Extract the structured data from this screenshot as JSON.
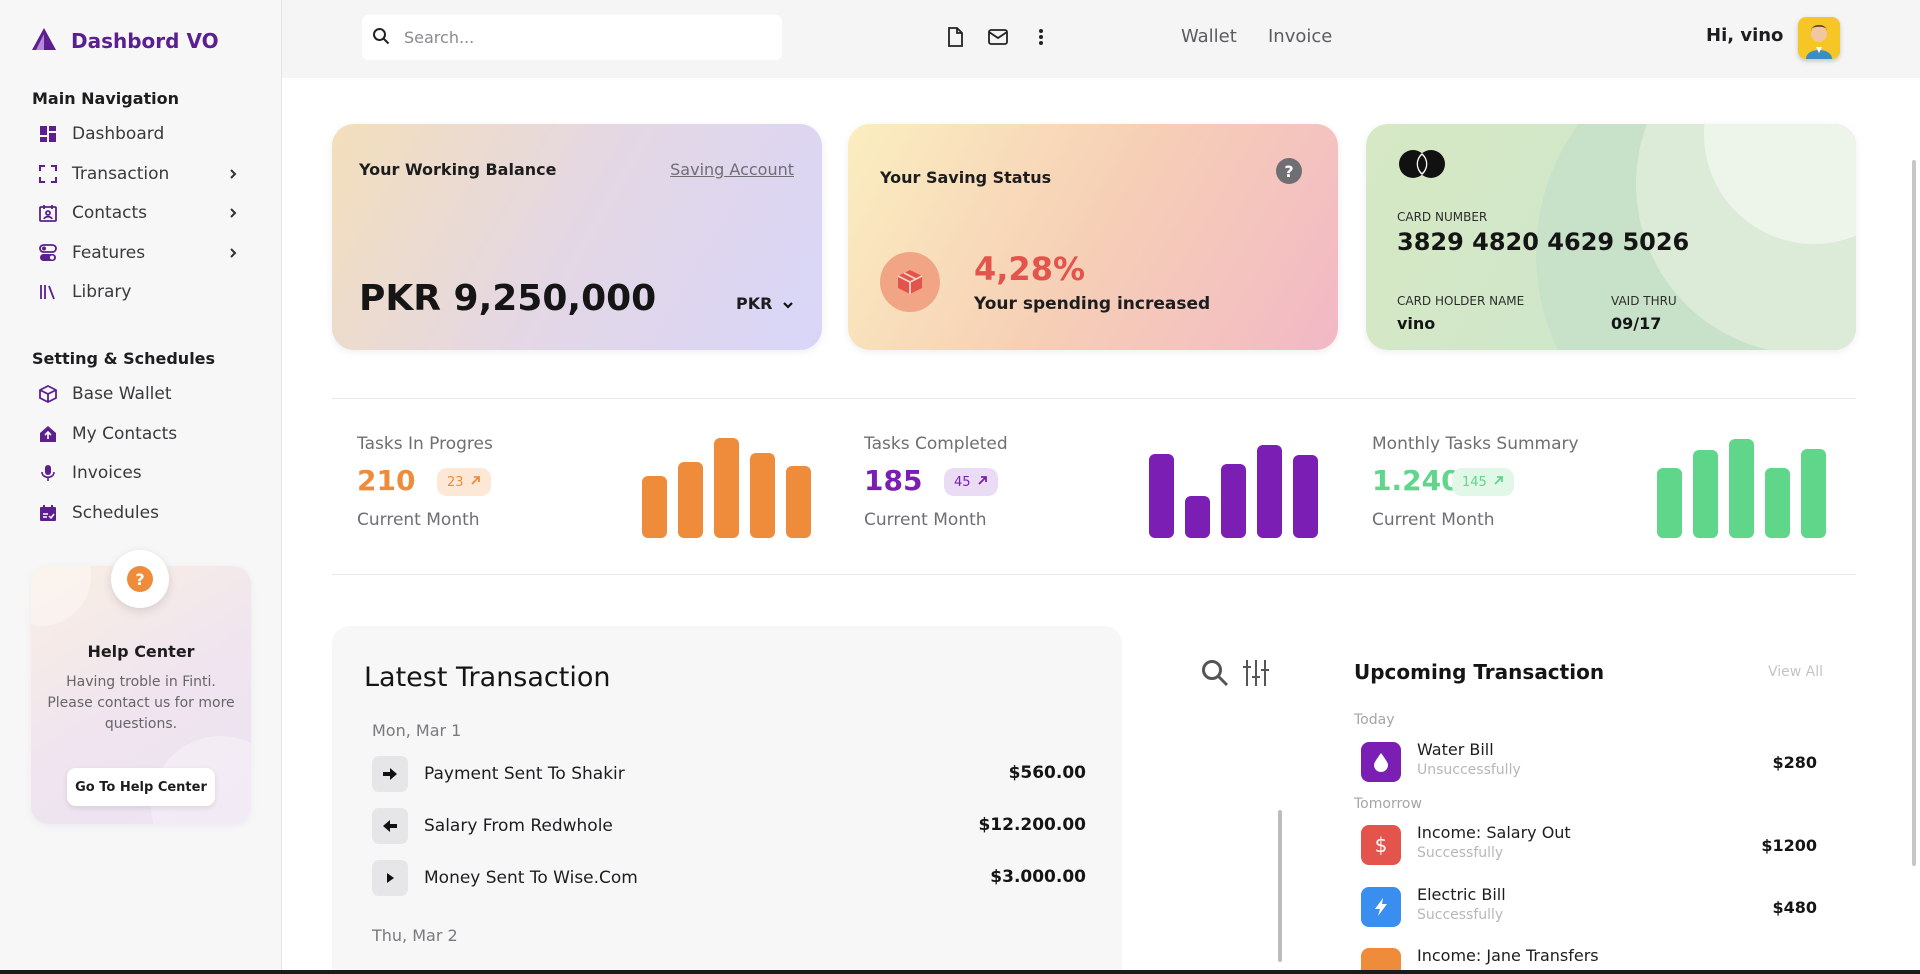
{
  "brand": {
    "name": "Dashbord VO"
  },
  "sidebar": {
    "main_heading": "Main Navigation",
    "main_items": [
      {
        "label": "Dashboard",
        "icon": "dashboard-icon",
        "has_chevron": false
      },
      {
        "label": "Transaction",
        "icon": "transaction-icon",
        "has_chevron": true
      },
      {
        "label": "Contacts",
        "icon": "contacts-icon",
        "has_chevron": true
      },
      {
        "label": "Features",
        "icon": "features-icon",
        "has_chevron": true
      },
      {
        "label": "Library",
        "icon": "library-icon",
        "has_chevron": false
      }
    ],
    "settings_heading": "Setting & Schedules",
    "settings_items": [
      {
        "label": "Base Wallet",
        "icon": "cube-icon"
      },
      {
        "label": "My Contacts",
        "icon": "home-upload-icon"
      },
      {
        "label": "Invoices",
        "icon": "microphone-icon"
      },
      {
        "label": "Schedules",
        "icon": "calendar-icon"
      }
    ],
    "help": {
      "title": "Help Center",
      "text": "Having troble in Finti. Please contact us for more questions.",
      "button": "Go To Help Center"
    },
    "accent_color": "#5b1f8f"
  },
  "topbar": {
    "search_placeholder": "Search...",
    "links": [
      "Wallet",
      "Invoice"
    ],
    "greeting": "Hi, vino"
  },
  "balance_card": {
    "title": "Your Working Balance",
    "link": "Saving Account",
    "amount": "PKR 9,250,000",
    "currency": "PKR"
  },
  "saving_card": {
    "title": "Your Saving Status",
    "percent": "4,28%",
    "subtitle": "Your spending increased"
  },
  "credit_card": {
    "number_label": "CARD NUMBER",
    "number": "3829 4820 4629 5026",
    "holder_label": "CARD HOLDER NAME",
    "holder": "vino",
    "valid_label": "VAID THRU",
    "valid": "09/17"
  },
  "stats": [
    {
      "label": "Tasks In Progres",
      "value": "210",
      "badge": "23",
      "sub": "Current Month",
      "color": "#ef8c3c",
      "badge_bg": "#fde7d6",
      "bars": [
        0.62,
        0.76,
        1.0,
        0.85,
        0.72
      ]
    },
    {
      "label": "Tasks Completed",
      "value": "185",
      "badge": "45",
      "sub": "Current Month",
      "color": "#7b1fb4",
      "badge_bg": "#eadcf5",
      "bars": [
        0.84,
        0.42,
        0.74,
        0.93,
        0.83
      ]
    },
    {
      "label": "Monthly Tasks Summary",
      "value": "1.240",
      "badge": "145",
      "sub": "Current Month",
      "color": "#5fd68a",
      "badge_bg": "#e1f7e8",
      "bars": [
        0.7,
        0.88,
        0.99,
        0.7,
        0.89
      ]
    }
  ],
  "latest": {
    "title": "Latest Transaction",
    "groups": [
      {
        "date": "Mon, Mar 1",
        "rows": [
          {
            "name": "Payment Sent To Shakir",
            "amount": "$560.00",
            "icon": "arrow-right-icon"
          },
          {
            "name": "Salary From Redwhole",
            "amount": "$12.200.00",
            "icon": "arrow-left-icon"
          },
          {
            "name": "Money Sent To Wise.Com",
            "amount": "$3.000.00",
            "icon": "play-icon"
          }
        ]
      },
      {
        "date": "Thu, Mar 2",
        "rows": []
      }
    ]
  },
  "upcoming": {
    "title": "Upcoming Transaction",
    "view_all": "View All",
    "days": [
      "Today",
      "Tomorrow"
    ],
    "rows": [
      {
        "name": "Water Bill",
        "status": "Unsuccessfully",
        "amount": "$280",
        "color": "#7b1fb4",
        "icon": "water-drop-icon"
      },
      {
        "name": "Income: Salary Out",
        "status": "Successfully",
        "amount": "$1200",
        "color": "#e2544c",
        "icon": "dollar-icon"
      },
      {
        "name": "Electric Bill",
        "status": "Successfully",
        "amount": "$480",
        "color": "#3a8ef0",
        "icon": "lightning-icon"
      },
      {
        "name": "Income: Jane Transfers",
        "status": "",
        "amount": "",
        "color": "#ef8c3c",
        "icon": "transfer-icon"
      }
    ]
  }
}
